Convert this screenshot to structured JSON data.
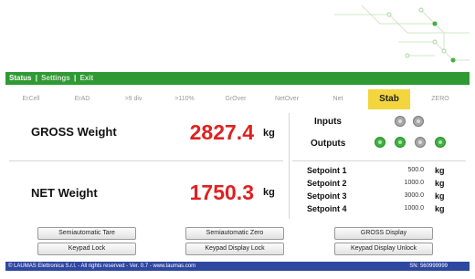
{
  "nav": {
    "status": "Status",
    "sep1": "|",
    "settings": "Settings",
    "sep2": "|",
    "exit": "Exit"
  },
  "indicators": [
    {
      "label": "ErCell",
      "active": false
    },
    {
      "label": "ErAD",
      "active": false
    },
    {
      "label": ">9 div",
      "active": false
    },
    {
      "label": ">110%",
      "active": false
    },
    {
      "label": "GrOver",
      "active": false
    },
    {
      "label": "NetOver",
      "active": false
    },
    {
      "label": "Net",
      "active": false
    },
    {
      "label": "Stab",
      "active": true
    },
    {
      "label": "ZERO",
      "active": false
    }
  ],
  "weights": {
    "gross": {
      "label": "GROSS Weight",
      "value": "2827.4",
      "unit": "kg"
    },
    "net": {
      "label": "NET Weight",
      "value": "1750.3",
      "unit": "kg"
    }
  },
  "io": {
    "inputs_label": "Inputs",
    "inputs": [
      "off",
      "off"
    ],
    "outputs_label": "Outputs",
    "outputs": [
      "on",
      "on",
      "off",
      "on"
    ]
  },
  "setpoints": [
    {
      "name": "Setpoint 1",
      "value": "500.0",
      "unit": "kg"
    },
    {
      "name": "Setpoint 2",
      "value": "1000.0",
      "unit": "kg"
    },
    {
      "name": "Setpoint 3",
      "value": "3000.0",
      "unit": "kg"
    },
    {
      "name": "Setpoint 4",
      "value": "1000.0",
      "unit": "kg"
    }
  ],
  "buttons": {
    "semi_tare": "Semiautomatic Tare",
    "semi_zero": "Semiautomatic Zero",
    "gross_display": "GROSS Display",
    "keypad_lock": "Keypad Lock",
    "keypad_display_lock": "Keypad Display Lock",
    "keypad_display_unlock": "Keypad Display Unlock"
  },
  "footer": {
    "copyright": "© LAUMAS Elettronica S.r.l. - All rights reserved - Ver. 0.7 - www.laumas.com",
    "serial": "SN: 560999999"
  },
  "colors": {
    "nav_green": "#2f9a34",
    "weight_red": "#e02020",
    "stab_yellow": "#f3d63d",
    "footer_blue": "#2e47a0",
    "led_on": "#3fb23f",
    "led_off": "#a8a8a8"
  }
}
